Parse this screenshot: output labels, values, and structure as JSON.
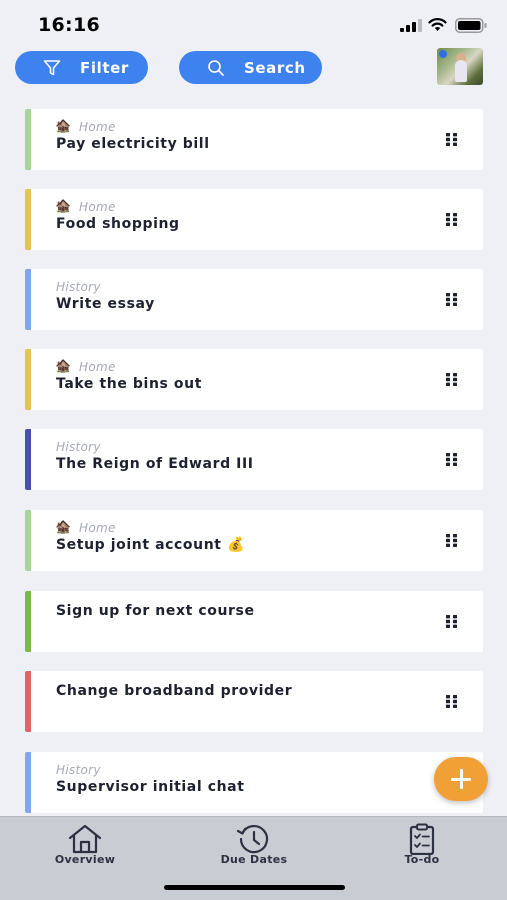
{
  "status_bar": {
    "time": "16:16",
    "icons": [
      "signal-icon",
      "wifi-icon",
      "battery-icon"
    ]
  },
  "header": {
    "filter_label": "Filter",
    "search_label": "Search",
    "filter_icon": "filter-icon",
    "search_icon": "search-icon",
    "avatar": "avatar"
  },
  "tasks": [
    {
      "category": "Home",
      "category_emoji": "🏚️",
      "title": "Pay electricity bill",
      "color": "#a8d49a"
    },
    {
      "category": "Home",
      "category_emoji": "🏚️",
      "title": "Food shopping",
      "color": "#e3c452"
    },
    {
      "category": "History",
      "category_emoji": "",
      "title": "Write essay",
      "color": "#7ea7f0"
    },
    {
      "category": "Home",
      "category_emoji": "🏚️",
      "title": "Take the bins out",
      "color": "#e3c452"
    },
    {
      "category": "History",
      "category_emoji": "",
      "title": "The Reign of Edward III",
      "color": "#4a4fae"
    },
    {
      "category": "Home",
      "category_emoji": "🏚️",
      "title": "Setup joint account 💰",
      "color": "#a8d49a"
    },
    {
      "category": "",
      "category_emoji": "",
      "title": "Sign up for next course",
      "color": "#7ab84a"
    },
    {
      "category": "",
      "category_emoji": "",
      "title": "Change broadband provider",
      "color": "#e06464"
    },
    {
      "category": "History",
      "category_emoji": "",
      "title": "Supervisor initial chat",
      "color": "#7ea7f0"
    }
  ],
  "fab": {
    "icon": "plus-icon",
    "color": "#f0a035"
  },
  "tab_bar": {
    "items": [
      {
        "label": "Overview",
        "icon": "home-icon"
      },
      {
        "label": "Due Dates",
        "icon": "history-clock-icon"
      },
      {
        "label": "To-do",
        "icon": "clipboard-icon"
      }
    ]
  },
  "colors": {
    "accent": "#3e82f0",
    "background": "#eef0f5",
    "tab_bar": "#c9ccd3"
  }
}
